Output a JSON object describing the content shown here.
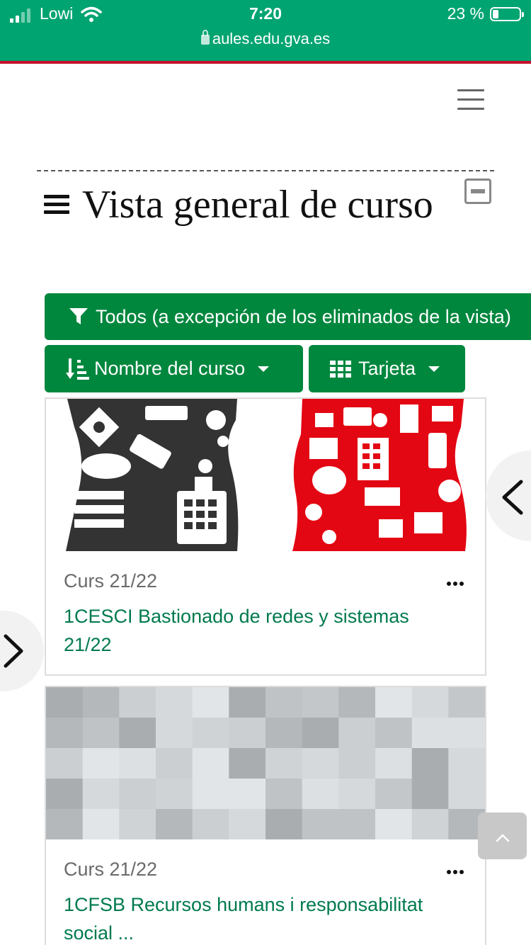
{
  "status_bar": {
    "carrier": "Lowi",
    "time": "7:20",
    "battery": "23 %",
    "url": "aules.edu.gva.es"
  },
  "block": {
    "title": "Vista general de curso"
  },
  "filters": {
    "grouping_label": "Todos (a excepción de los eliminados de la vista)",
    "sort_label": "Nombre del curso",
    "view_label": "Tarjeta"
  },
  "courses": [
    {
      "category": "Curs 21/22",
      "name": "1CESCI Bastionado de redes y sistemas 21/22"
    },
    {
      "category": "Curs 21/22",
      "name": "1CFSB Recursos humans i responsabilitat social ..."
    }
  ],
  "colors": {
    "status_bar": "#00a471",
    "accent_line": "#c8102e",
    "button": "#00873e",
    "course_link": "#007a4d"
  }
}
